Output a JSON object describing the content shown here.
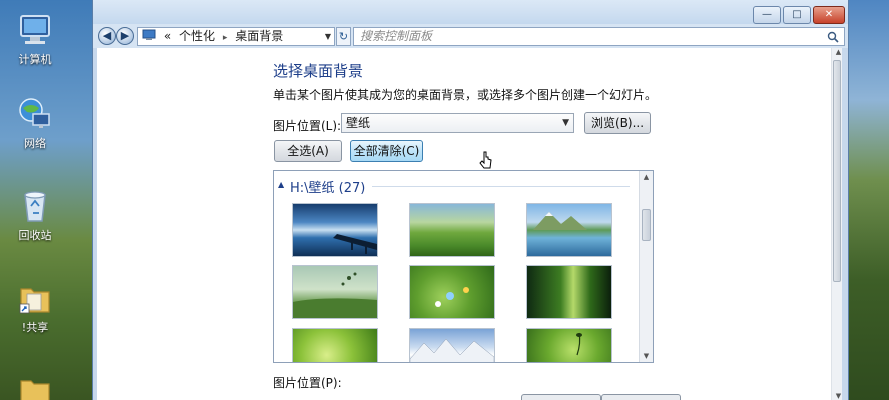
{
  "desktop": {
    "icons": [
      {
        "label": "计算机",
        "icon": "computer-icon"
      },
      {
        "label": "网络",
        "icon": "network-icon"
      },
      {
        "label": "回收站",
        "icon": "recycle-bin-icon"
      },
      {
        "label": "!共享",
        "icon": "shared-folder-icon"
      }
    ]
  },
  "window": {
    "controls": {
      "minimize": "—",
      "maximize": "□",
      "close": "✕"
    },
    "address": {
      "prefix": "«",
      "crumb1": "个性化",
      "separator": "▸",
      "crumb2": "桌面背景",
      "refresh": "↻",
      "search_placeholder": "搜索控制面板"
    }
  },
  "page": {
    "title": "选择桌面背景",
    "description": "单击某个图片使其成为您的桌面背景，或选择多个图片创建一个幻灯片。",
    "location_label": "图片位置(L):",
    "location_value": "壁纸",
    "browse_label": "浏览(B)...",
    "select_all_label": "全选(A)",
    "clear_all_label": "全部清除(C)",
    "group_header": "H:\\壁纸 (27)",
    "position_label": "图片位置(P):"
  },
  "colors": {
    "accent": "#1e3f8a",
    "window_frame": "#c7d8ec"
  }
}
